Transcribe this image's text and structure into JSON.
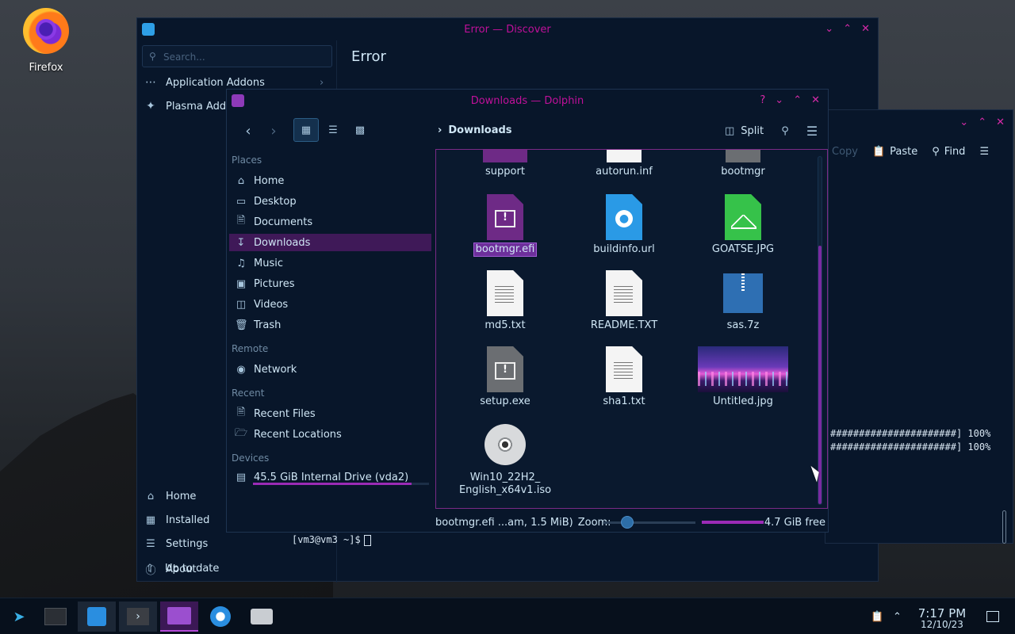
{
  "desktop": {
    "firefox_label": "Firefox"
  },
  "discover": {
    "title": "Error — Discover",
    "search_placeholder": "Search...",
    "sidebar": [
      {
        "label": "Application Addons",
        "icon": "dots-icon"
      },
      {
        "label": "Plasma Addo",
        "icon": "puzzle-icon"
      }
    ],
    "bottom": [
      {
        "label": "Home",
        "icon": "home-icon"
      },
      {
        "label": "Installed",
        "icon": "grid-icon"
      },
      {
        "label": "Settings",
        "icon": "sliders-icon"
      },
      {
        "label": "About",
        "icon": "info-icon"
      },
      {
        "label": "Up to date",
        "icon": "arrow-up-icon"
      }
    ],
    "main_title": "Error"
  },
  "konsole": {
    "toolbar": {
      "copy": "Copy",
      "paste": "Paste",
      "find": "Find"
    },
    "output": [
      "######################] 100%",
      "######################] 100%"
    ],
    "prompt": "[vm3@vm3 ~]$"
  },
  "dolphin": {
    "title": "Downloads — Dolphin",
    "breadcrumb": "Downloads",
    "split_label": "Split",
    "places": {
      "headers": {
        "places": "Places",
        "remote": "Remote",
        "recent": "Recent",
        "devices": "Devices"
      },
      "items": [
        {
          "label": "Home",
          "icon": "home-icon"
        },
        {
          "label": "Desktop",
          "icon": "desktop-icon"
        },
        {
          "label": "Documents",
          "icon": "document-icon"
        },
        {
          "label": "Downloads",
          "icon": "download-icon"
        },
        {
          "label": "Music",
          "icon": "music-icon"
        },
        {
          "label": "Pictures",
          "icon": "picture-icon"
        },
        {
          "label": "Videos",
          "icon": "video-icon"
        },
        {
          "label": "Trash",
          "icon": "trash-icon"
        }
      ],
      "remote": [
        {
          "label": "Network",
          "icon": "network-icon"
        }
      ],
      "recent": [
        {
          "label": "Recent Files",
          "icon": "recent-files-icon"
        },
        {
          "label": "Recent Locations",
          "icon": "recent-locations-icon"
        }
      ],
      "devices": [
        {
          "label": "45.5 GiB Internal Drive (vda2)",
          "icon": "drive-icon"
        }
      ]
    },
    "files": [
      {
        "name": "support"
      },
      {
        "name": "autorun.inf"
      },
      {
        "name": "bootmgr"
      },
      {
        "name": "bootmgr.efi",
        "selected": true
      },
      {
        "name": "buildinfo.url"
      },
      {
        "name": "GOATSE.JPG"
      },
      {
        "name": "md5.txt"
      },
      {
        "name": "README.TXT"
      },
      {
        "name": "sas.7z"
      },
      {
        "name": "setup.exe"
      },
      {
        "name": "sha1.txt"
      },
      {
        "name": "Untitled.jpg"
      },
      {
        "name": "Win10_22H2_",
        "name2": "English_x64v1.iso"
      }
    ],
    "status": {
      "selection": "bootmgr.efi ...am, 1.5 MiB)",
      "zoom_label": "Zoom:",
      "free_space": "4.7 GiB free"
    }
  },
  "taskbar": {
    "clock_time": "7:17 PM",
    "clock_date": "12/10/23"
  },
  "colors": {
    "accent": "#c0109a",
    "selection": "#3f1958",
    "window_bg": "#08162a"
  }
}
